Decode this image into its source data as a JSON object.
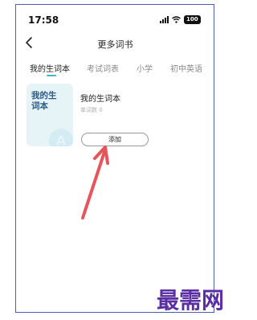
{
  "status_bar": {
    "time": "17:58",
    "battery": "100"
  },
  "header": {
    "title": "更多词书"
  },
  "tabs": [
    {
      "label": "我的生词本",
      "active": true
    },
    {
      "label": "考试词表",
      "active": false
    },
    {
      "label": "小学",
      "active": false
    },
    {
      "label": "初中英语",
      "active": false
    }
  ],
  "book": {
    "cover_title": "我的生词本",
    "cover_letter": "A",
    "name": "我的生词本",
    "word_count": "单词数 0",
    "add_label": "添加"
  },
  "watermark": "最需网",
  "colors": {
    "accent": "#3fb9c9",
    "arrow": "#e8545a",
    "watermark": "#5b2fa3",
    "frame": "#4a5fb0"
  }
}
